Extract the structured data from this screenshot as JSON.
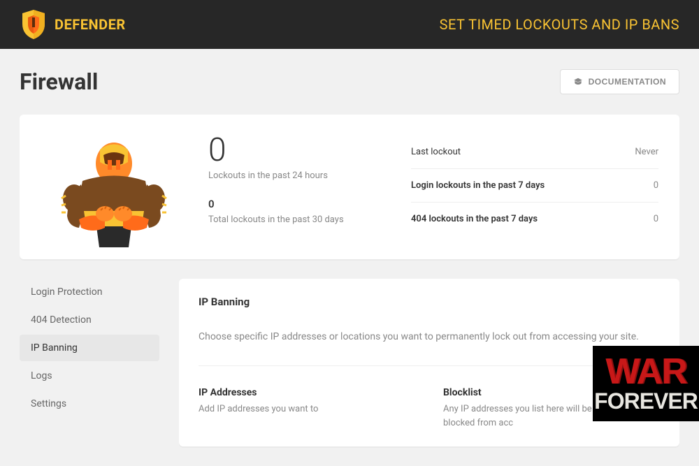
{
  "brand": {
    "name": "DEFENDER"
  },
  "tagline": "SET TIMED LOCKOUTS AND IP BANS",
  "page": {
    "title": "Firewall",
    "doc_button": "DOCUMENTATION"
  },
  "stats": {
    "lockouts_24h": {
      "value": "0",
      "label": "Lockouts in the past 24 hours"
    },
    "lockouts_30d": {
      "value": "0",
      "label": "Total lockouts in the past 30 days"
    },
    "rows": [
      {
        "k": "Last lockout",
        "v": "Never"
      },
      {
        "k": "Login lockouts in the past 7 days",
        "v": "0"
      },
      {
        "k": "404 lockouts in the past 7 days",
        "v": "0"
      }
    ]
  },
  "nav": {
    "items": [
      {
        "label": "Login Protection"
      },
      {
        "label": "404 Detection"
      },
      {
        "label": "IP Banning",
        "active": true
      },
      {
        "label": "Logs"
      },
      {
        "label": "Settings"
      }
    ]
  },
  "panel": {
    "title": "IP Banning",
    "desc": "Choose specific IP addresses or locations you want to permanently lock out from accessing your site.",
    "cols": [
      {
        "title": "IP Addresses",
        "desc": "Add IP addresses you want to"
      },
      {
        "title": "Blocklist",
        "desc": "Any IP addresses you list here will be completely blocked from acc"
      }
    ]
  },
  "overlay": {
    "line1": "WAR",
    "line2": "FOREVER"
  }
}
